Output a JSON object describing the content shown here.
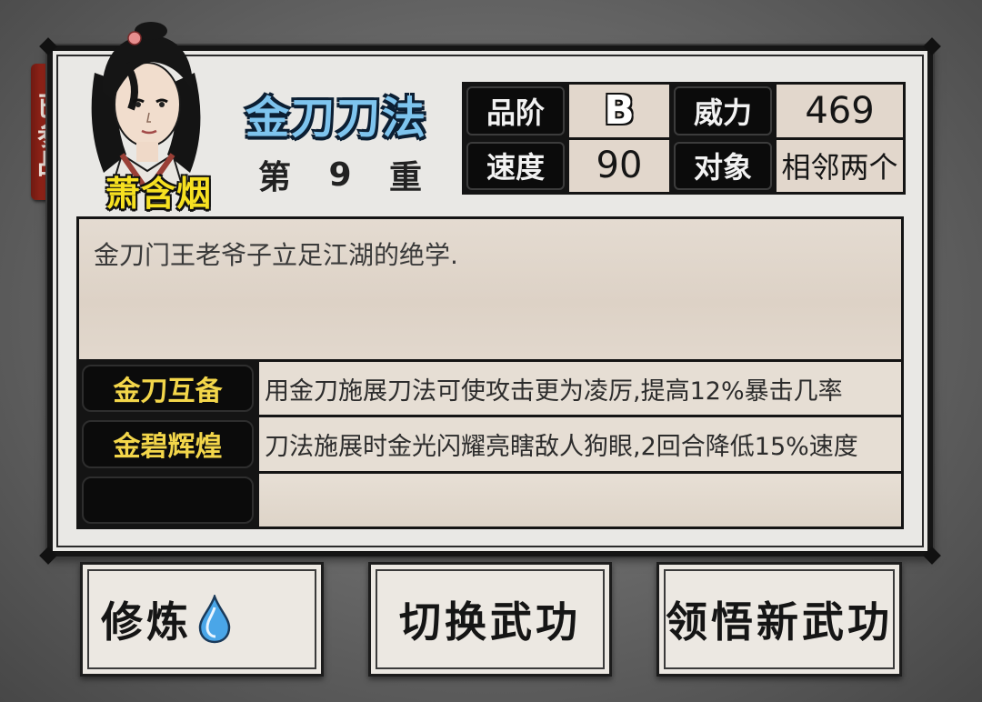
{
  "status_ribbon": "已参战",
  "character": {
    "name": "萧含烟"
  },
  "skill": {
    "name": "金刀刀法",
    "level": {
      "prefix": "第",
      "number": "9",
      "suffix": "重"
    },
    "stats": [
      {
        "label": "品阶",
        "value": "B"
      },
      {
        "label": "威力",
        "value": "469"
      },
      {
        "label": "速度",
        "value": "90"
      },
      {
        "label": "对象",
        "value": "相邻两个"
      }
    ],
    "description": "金刀门王老爷子立足江湖的绝学.",
    "traits": [
      {
        "name": "金刀互备",
        "effect": "用金刀施展刀法可使攻击更为凌厉,提高12%暴击几率"
      },
      {
        "name": "金碧辉煌",
        "effect": "刀法施展时金光闪耀亮瞎敌人狗眼,2回合降低15%速度"
      },
      {
        "name": "",
        "effect": ""
      }
    ]
  },
  "buttons": {
    "train": "修炼",
    "switch": "切换武功",
    "learn": "领悟新武功"
  },
  "icons": {
    "train_icon": "water-drop-icon"
  },
  "colors": {
    "title": "#7ec4ee",
    "character_name": "#f6e021",
    "trait_name": "#f3d64a",
    "ribbon": "#a4281b",
    "drop_icon": "#4aa6e8"
  }
}
